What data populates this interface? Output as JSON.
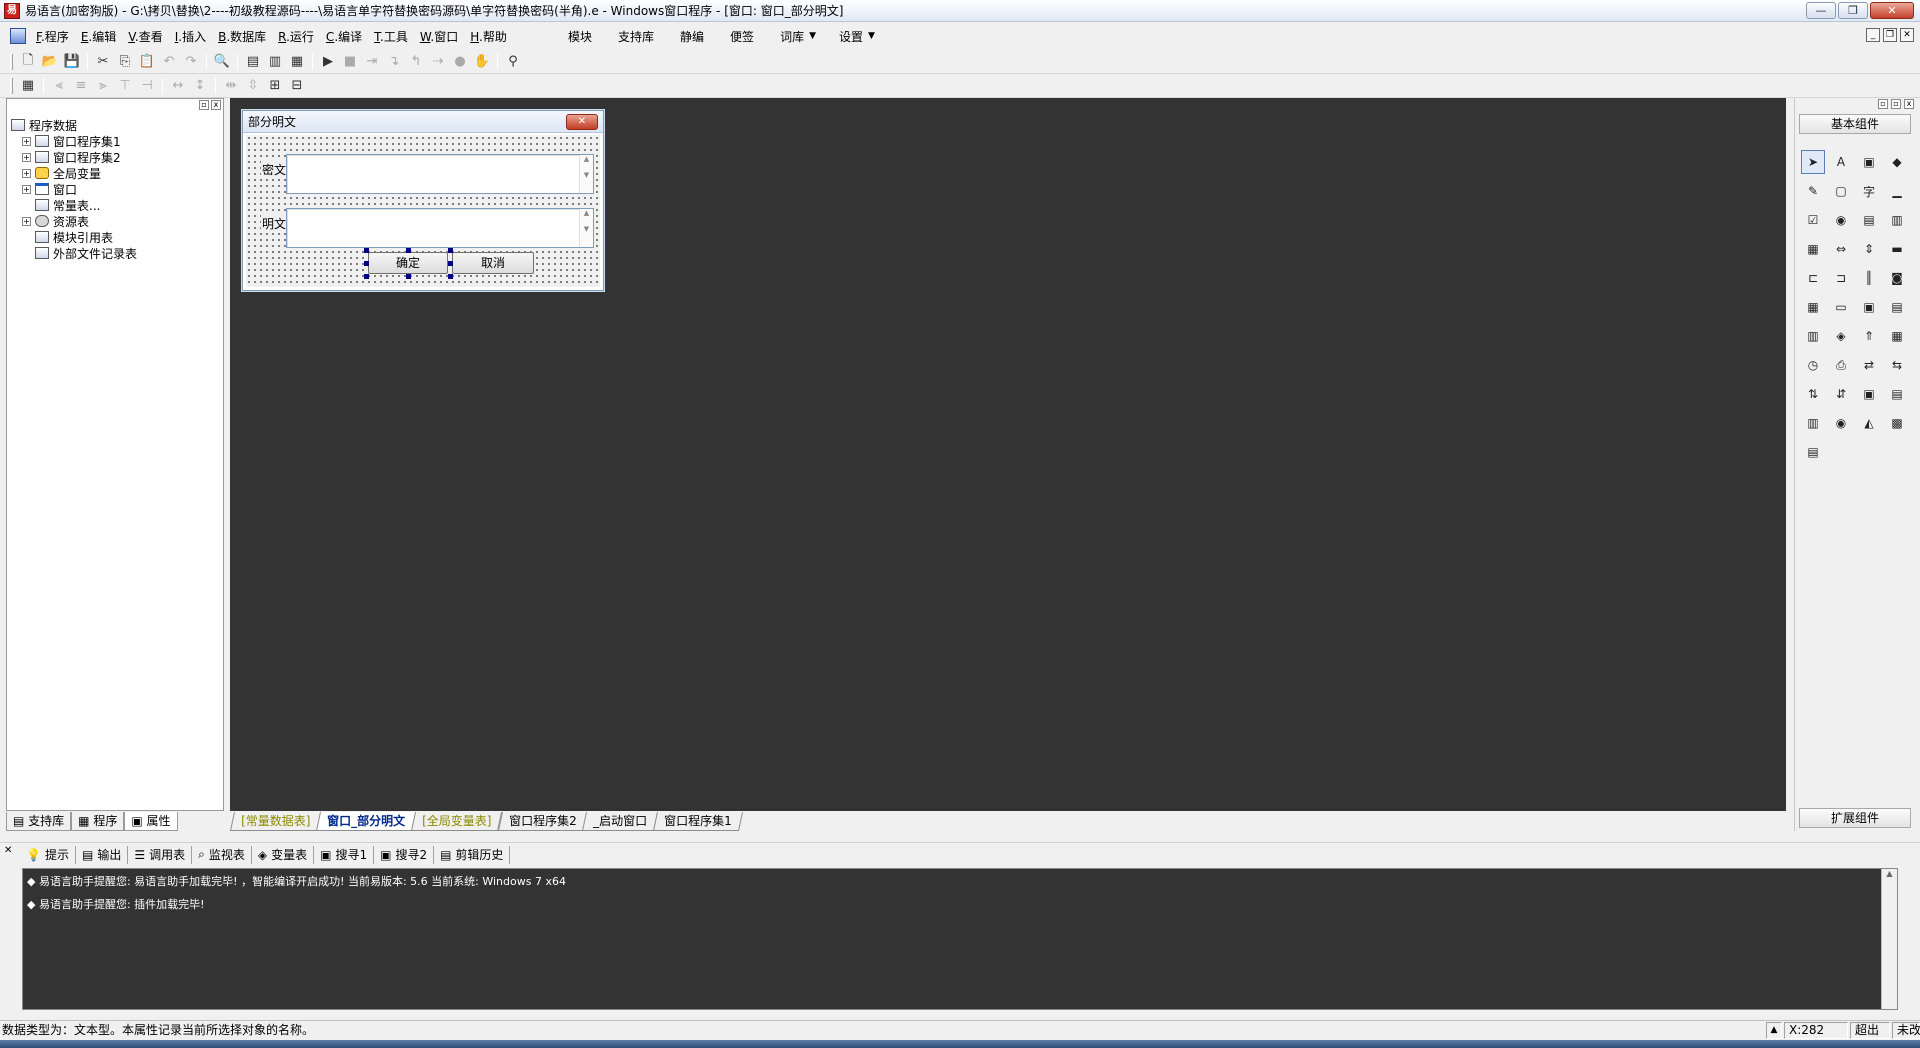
{
  "window": {
    "title": "易语言(加密狗版) - G:\\拷贝\\替换\\2----初级教程源码----\\易语言单字符替换密码源码\\单字符替换密码(半角).e - Windows窗口程序 - [窗口: 窗口_部分明文]",
    "minimize": "—",
    "restore": "❐",
    "close": "✕"
  },
  "menu": {
    "items": [
      {
        "key": "F",
        "label": ".程序"
      },
      {
        "key": "E",
        "label": ".编辑"
      },
      {
        "key": "V",
        "label": ".查看"
      },
      {
        "key": "I",
        "label": ".插入"
      },
      {
        "key": "B",
        "label": ".数据库"
      },
      {
        "key": "R",
        "label": ".运行"
      },
      {
        "key": "C",
        "label": ".编译"
      },
      {
        "key": "T",
        "label": ".工具"
      },
      {
        "key": "W",
        "label": ".窗口"
      },
      {
        "key": "H",
        "label": ".帮助"
      }
    ],
    "right_items": [
      "模块",
      "支持库",
      "静编",
      "便签",
      "词库",
      "设置"
    ],
    "mdi_minimize": "_",
    "mdi_restore": "❐",
    "mdi_close": "✕"
  },
  "toolbar1": [
    "new-file-icon",
    "open-folder-icon",
    "save-icon",
    "|",
    "cut-icon",
    "copy-icon",
    "paste-icon",
    "undo-icon",
    "redo-icon",
    "|",
    "find-icon",
    "|",
    "layout1-icon",
    "layout2-icon",
    "layout3-icon",
    "|",
    "run-icon",
    "stop-icon",
    "step-icon",
    "step-into-icon",
    "step-out-icon",
    "run-to-cursor-icon",
    "breakpoint-icon",
    "hand-icon",
    "|",
    "binoculars-icon"
  ],
  "toolbar2": [
    "grid-icon",
    "|",
    "align-left-icon",
    "align-center-icon",
    "align-right-icon",
    "align-top-icon",
    "align-middle-icon",
    "|",
    "same-width-icon",
    "same-height-icon",
    "|",
    "space-h-icon",
    "space-v-icon",
    "center-h-icon",
    "center-v-icon"
  ],
  "left_panel": {
    "tree": [
      {
        "label": "程序数据",
        "level": 0,
        "exp": "",
        "icon": "tree-root-icon"
      },
      {
        "label": "窗口程序集1",
        "level": 1,
        "exp": "+",
        "icon": "module-icon"
      },
      {
        "label": "窗口程序集2",
        "level": 1,
        "exp": "+",
        "icon": "module-icon"
      },
      {
        "label": "全局变量",
        "level": 1,
        "exp": "+",
        "icon": "database-icon"
      },
      {
        "label": "窗口",
        "level": 1,
        "exp": "+",
        "icon": "window-icon"
      },
      {
        "label": "常量表...",
        "level": 1,
        "exp": "",
        "icon": "constants-icon"
      },
      {
        "label": "资源表",
        "level": 1,
        "exp": "+",
        "icon": "resources-icon"
      },
      {
        "label": "模块引用表",
        "level": 1,
        "exp": "",
        "icon": "module-ref-icon"
      },
      {
        "label": "外部文件记录表",
        "level": 1,
        "exp": "",
        "icon": "external-file-icon"
      }
    ],
    "tabs": [
      "支持库",
      "程序",
      "属性"
    ]
  },
  "form": {
    "title": "部分明文",
    "close": "✕",
    "label_cipher": "密文",
    "label_plain": "明文",
    "ok_button": "确定",
    "cancel_button": "取消"
  },
  "doc_tabs": [
    {
      "label": "[常量数据表]",
      "style": "olive"
    },
    {
      "label": "窗口_部分明文",
      "style": "active"
    },
    {
      "label": "[全局变量表]",
      "style": "olive"
    },
    {
      "label": "窗口程序集2",
      "style": ""
    },
    {
      "label": "_启动窗口",
      "style": ""
    },
    {
      "label": "窗口程序集1",
      "style": ""
    }
  ],
  "toolbox": {
    "header": "基本组件",
    "footer": "扩展组件",
    "tools": [
      "➤",
      "A",
      "▣",
      "◆",
      "✎",
      "▢",
      "字",
      "▁",
      "☑",
      "◉",
      "▤",
      "▥",
      "▦",
      "⇔",
      "⇕",
      "▬",
      "⊏",
      "⊐",
      "║",
      "◙",
      "▦",
      "▭",
      "▣",
      "▤",
      "▥",
      "◈",
      "⇑",
      "▦",
      "◷",
      "⎙",
      "⇄",
      "⇆",
      "⇅",
      "⇵",
      "▣",
      "▤",
      "▥",
      "◉",
      "◭",
      "▩",
      "▤"
    ]
  },
  "output": {
    "tabs": [
      {
        "icon": "💡",
        "label": "提示"
      },
      {
        "icon": "▤",
        "label": "输出"
      },
      {
        "icon": "☰",
        "label": "调用表"
      },
      {
        "icon": "⌕",
        "label": "监视表"
      },
      {
        "icon": "◈",
        "label": "变量表"
      },
      {
        "icon": "▣",
        "label": "搜寻1"
      },
      {
        "icon": "▣",
        "label": "搜寻2"
      },
      {
        "icon": "▤",
        "label": "剪辑历史"
      }
    ],
    "lines": [
      "◆ 易语言助手提醒您: 易语言助手加载完毕! ，智能编译开启成功! 当前易版本: 5.6  当前系统: Windows 7 x64",
      "◆ 易语言助手提醒您: 插件加载完毕!"
    ]
  },
  "status": {
    "text": "数据类型为：文本型。本属性记录当前所选择对象的名称。",
    "coord": "X:282",
    "mode": "超出",
    "saved": "未改"
  }
}
